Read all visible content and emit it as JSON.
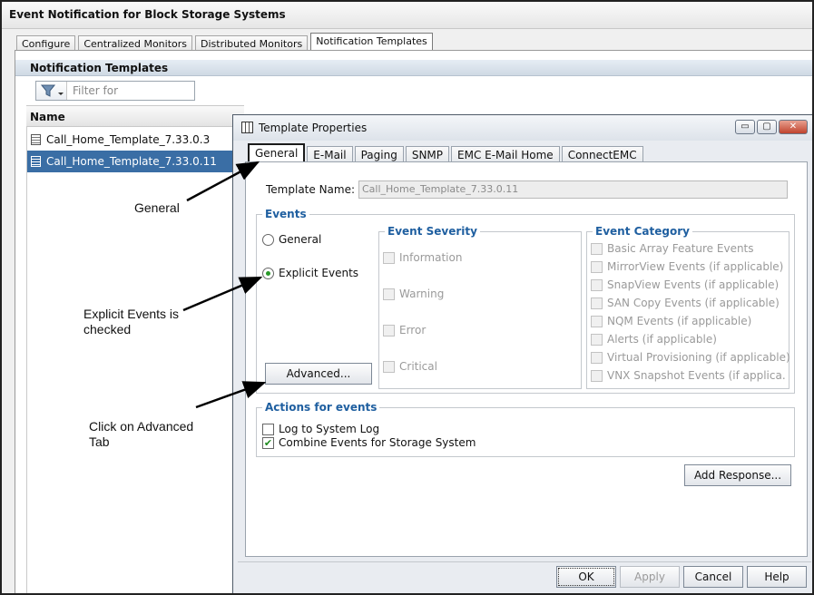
{
  "app": {
    "title": "Event Notification for Block Storage Systems"
  },
  "main_tabs": [
    "Configure",
    "Centralized Monitors",
    "Distributed Monitors",
    "Notification Templates"
  ],
  "templates_panel": {
    "header": "Notification Templates",
    "filter_placeholder": "Filter for",
    "column_header": "Name",
    "rows": [
      "Call_Home_Template_7.33.0.3",
      "Call_Home_Template_7.33.0.11"
    ]
  },
  "dialog": {
    "title": "Template Properties",
    "window_buttons": {
      "minimize": "▭",
      "maximize": "▢",
      "close": "✕"
    },
    "tabs": [
      "General",
      "E-Mail",
      "Paging",
      "SNMP",
      "EMC E-Mail Home",
      "ConnectEMC"
    ],
    "template_name_label": "Template Name:",
    "template_name_value": "Call_Home_Template_7.33.0.11",
    "events": {
      "legend": "Events",
      "general_label": "General",
      "explicit_label": "Explicit Events",
      "advanced_button": "Advanced..."
    },
    "severity": {
      "legend": "Event Severity",
      "items": [
        "Information",
        "Warning",
        "Error",
        "Critical"
      ]
    },
    "category": {
      "legend": "Event Category",
      "items": [
        "Basic Array Feature Events",
        "MirrorView Events (if applicable)",
        "SnapView Events (if applicable)",
        "SAN Copy Events (if applicable)",
        "NQM Events (if applicable)",
        "Alerts (if applicable)",
        "Virtual Provisioning (if applicable)",
        "VNX Snapshot Events (if applica..."
      ]
    },
    "actions": {
      "legend": "Actions for events",
      "log_label": "Log to System Log",
      "combine_label": "Combine Events for Storage System",
      "combine_checkmark": "✔"
    },
    "add_response_button": "Add Response...",
    "buttons": {
      "ok": "OK",
      "apply": "Apply",
      "cancel": "Cancel",
      "help": "Help"
    }
  },
  "annotations": {
    "general": "General",
    "explicit_line1": "Explicit Events is",
    "explicit_line2": "checked",
    "advanced_line1": "Click on Advanced",
    "advanced_line2": "Tab"
  },
  "icons": {
    "filter": "funnel-icon",
    "template": "document-icon",
    "dialog": "table-icon"
  }
}
